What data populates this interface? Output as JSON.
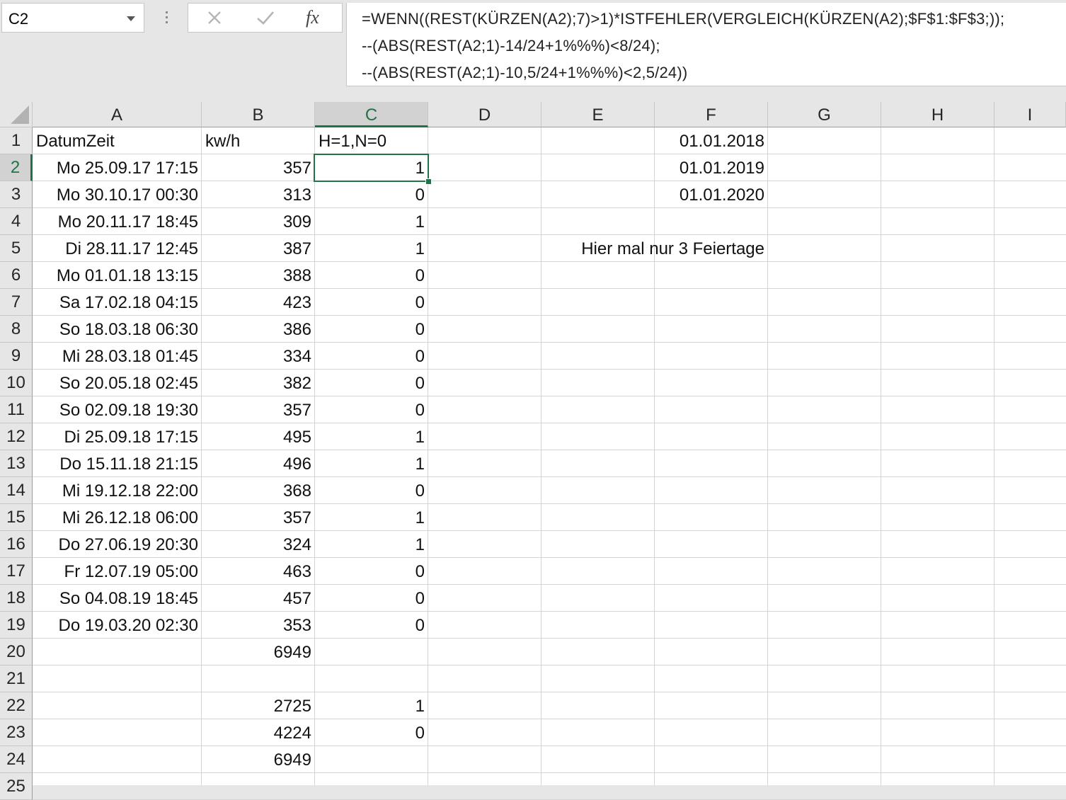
{
  "name_box": "C2",
  "formula_bar": {
    "line1": "=WENN((REST(KÜRZEN(A2);7)>1)*ISTFEHLER(VERGLEICH(KÜRZEN(A2);$F$1:$F$3;));",
    "line2": "--(ABS(REST(A2;1)-14/24+1%%%)<8/24);",
    "line3": "--(ABS(REST(A2;1)-10,5/24+1%%%)<2,5/24))"
  },
  "column_headers": [
    "A",
    "B",
    "C",
    "D",
    "E",
    "F",
    "G",
    "H",
    "I"
  ],
  "row_headers": [
    "1",
    "2",
    "3",
    "4",
    "5",
    "6",
    "7",
    "8",
    "9",
    "10",
    "11",
    "12",
    "13",
    "14",
    "15",
    "16",
    "17",
    "18",
    "19",
    "20",
    "21",
    "22",
    "23",
    "24",
    "25"
  ],
  "selected_cell": {
    "column": "C",
    "row": "2"
  },
  "rows": [
    {
      "A": "DatumZeit",
      "B": "kw/h",
      "C": "H=1,N=0",
      "F": "01.01.2018"
    },
    {
      "A": "Mo 25.09.17 17:15",
      "B": "357",
      "C": "1",
      "F": "01.01.2019"
    },
    {
      "A": "Mo 30.10.17 00:30",
      "B": "313",
      "C": "0",
      "F": "01.01.2020"
    },
    {
      "A": "Mo 20.11.17 18:45",
      "B": "309",
      "C": "1"
    },
    {
      "A": "Di 28.11.17 12:45",
      "B": "387",
      "C": "1",
      "E": "Hier mal nur 3 Feiertage"
    },
    {
      "A": "Mo 01.01.18 13:15",
      "B": "388",
      "C": "0"
    },
    {
      "A": "Sa 17.02.18 04:15",
      "B": "423",
      "C": "0"
    },
    {
      "A": "So 18.03.18 06:30",
      "B": "386",
      "C": "0"
    },
    {
      "A": "Mi 28.03.18 01:45",
      "B": "334",
      "C": "0"
    },
    {
      "A": "So 20.05.18 02:45",
      "B": "382",
      "C": "0"
    },
    {
      "A": "So 02.09.18 19:30",
      "B": "357",
      "C": "0"
    },
    {
      "A": "Di 25.09.18 17:15",
      "B": "495",
      "C": "1"
    },
    {
      "A": "Do 15.11.18 21:15",
      "B": "496",
      "C": "1"
    },
    {
      "A": "Mi 19.12.18 22:00",
      "B": "368",
      "C": "0"
    },
    {
      "A": "Mi 26.12.18 06:00",
      "B": "357",
      "C": "1"
    },
    {
      "A": "Do 27.06.19 20:30",
      "B": "324",
      "C": "1"
    },
    {
      "A": "Fr 12.07.19 05:00",
      "B": "463",
      "C": "0"
    },
    {
      "A": "So 04.08.19 18:45",
      "B": "457",
      "C": "0"
    },
    {
      "A": "Do 19.03.20 02:30",
      "B": "353",
      "C": "0"
    },
    {
      "B": "6949"
    },
    {},
    {
      "B": "2725",
      "C": "1"
    },
    {
      "B": "4224",
      "C": "0"
    },
    {
      "B": "6949"
    },
    {}
  ],
  "colors": {
    "accent": "#217346",
    "gridline": "#d4d4d4",
    "header_bg": "#e6e6e6"
  }
}
